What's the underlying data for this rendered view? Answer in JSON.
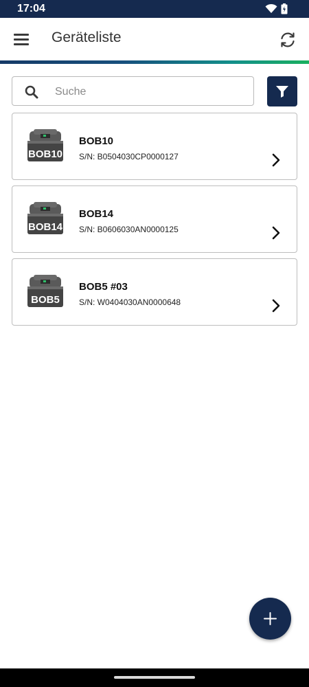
{
  "status_bar": {
    "time": "17:04"
  },
  "app_bar": {
    "title": "Geräteliste"
  },
  "search": {
    "placeholder": "Suche",
    "value": ""
  },
  "devices": [
    {
      "name": "BOB10",
      "serial": "S/N: B0504030CP0000127",
      "badge": "BOB10"
    },
    {
      "name": "BOB14",
      "serial": "S/N: B0606030AN0000125",
      "badge": "BOB14"
    },
    {
      "name": "BOB5 #03",
      "serial": "S/N: W0404030AN0000648",
      "badge": "BOB5"
    }
  ],
  "colors": {
    "primary": "#152a4f",
    "accent_gradient_end": "#1ab05f"
  }
}
